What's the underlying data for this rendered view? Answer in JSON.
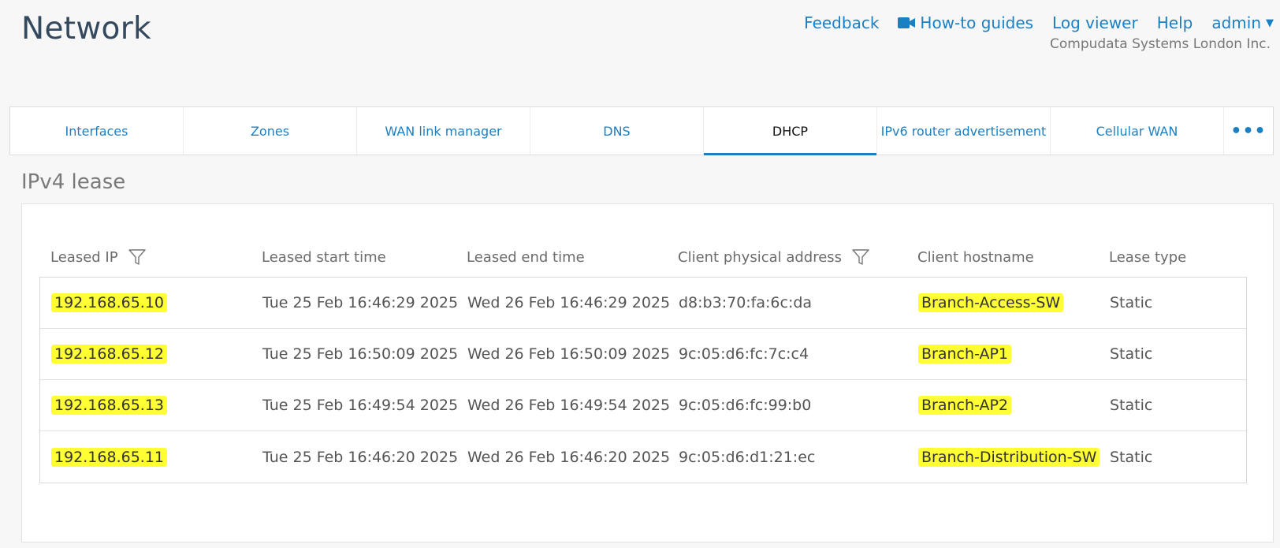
{
  "page_title": "Network",
  "top_links": {
    "feedback": "Feedback",
    "howto": "How-to guides",
    "logviewer": "Log viewer",
    "help": "Help",
    "admin": "admin"
  },
  "org_name": "Compudata Systems London Inc.",
  "tabs": [
    {
      "label": "Interfaces"
    },
    {
      "label": "Zones"
    },
    {
      "label": "WAN link manager"
    },
    {
      "label": "DNS"
    },
    {
      "label": "DHCP",
      "active": true
    },
    {
      "label": "IPv6 router advertisement"
    },
    {
      "label": "Cellular WAN"
    },
    {
      "label": "•••"
    }
  ],
  "section_title": "IPv4 lease",
  "table": {
    "headers": [
      "Leased IP",
      "Leased start time",
      "Leased end time",
      "Client physical address",
      "Client hostname",
      "Lease type"
    ],
    "rows": [
      {
        "ip": "192.168.65.10",
        "start": "Tue 25 Feb 16:46:29 2025",
        "end": "Wed 26 Feb 16:46:29 2025",
        "mac": "d8:b3:70:fa:6c:da",
        "host": "Branch-Access-SW",
        "type": "Static"
      },
      {
        "ip": "192.168.65.12",
        "start": "Tue 25 Feb 16:50:09 2025",
        "end": "Wed 26 Feb 16:50:09 2025",
        "mac": "9c:05:d6:fc:7c:c4",
        "host": "Branch-AP1",
        "type": "Static"
      },
      {
        "ip": "192.168.65.13",
        "start": "Tue 25 Feb 16:49:54 2025",
        "end": "Wed 26 Feb 16:49:54 2025",
        "mac": "9c:05:d6:fc:99:b0",
        "host": "Branch-AP2",
        "type": "Static"
      },
      {
        "ip": "192.168.65.11",
        "start": "Tue 25 Feb 16:46:20 2025",
        "end": "Wed 26 Feb 16:46:20 2025",
        "mac": "9c:05:d6:d1:21:ec",
        "host": "Branch-Distribution-SW",
        "type": "Static"
      }
    ]
  },
  "colors": {
    "accent": "#1b7fc4",
    "highlight": "#ffff33"
  },
  "icons": {
    "filter": "filter-icon",
    "video": "video-camera-icon",
    "caret": "caret-down-icon",
    "more": "more-horizontal-icon"
  }
}
